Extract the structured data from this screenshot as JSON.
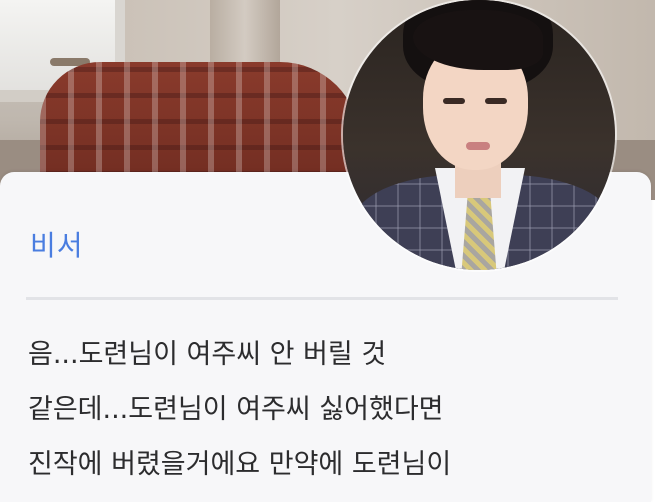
{
  "dialogue": {
    "speaker": "비서",
    "message_lines": [
      "음...도련님이 여주씨 안 버릴 것",
      "같은데...도련님이 여주씨 싫어했다면",
      "진작에 버렸을거에요 만약에 도련님이"
    ]
  },
  "colors": {
    "speaker_name": "#4a7de0",
    "card_background": "#f7f7f9",
    "message_text": "#2c2c2e",
    "divider": "#e2e3e7"
  }
}
